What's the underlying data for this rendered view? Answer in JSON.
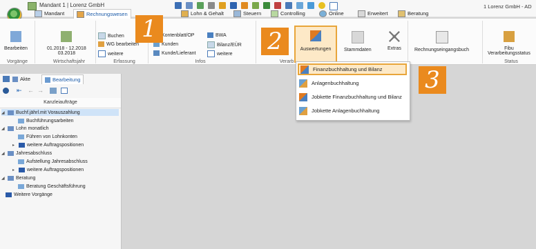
{
  "title_bar": {
    "mandant": "Mandant 1 | Lorenz GmbH",
    "right_text": "1 Lorenz GmbH - AD"
  },
  "ribbon_tabs": [
    "Mandant",
    "Rechnungswesen",
    "Lohn & Gehalt",
    "Steuern",
    "Controlling",
    "Online",
    "Erweitert",
    "Beratung"
  ],
  "ribbon": {
    "vorgaenge": {
      "bearbeiten": "Bearbeiten",
      "group": "Vorgänge"
    },
    "wirtschaftsjahr": {
      "range": "01.2018 - 12.2018",
      "current": "03.2018",
      "group": "Wirtschaftsjahr"
    },
    "erfassung": {
      "buchen": "Buchen",
      "wg": "WG bearbeiten",
      "weitere": "weitere",
      "group": "Erfassung"
    },
    "infos": {
      "kontenblatt": "Kontenblatt/OP",
      "kunden": "Kunden",
      "kunde_lieferant": "Kunde/Lieferant",
      "bwa": "BWA",
      "bilanz": "Bilanz/EÜR",
      "weitere": "weitere",
      "group": "Infos"
    },
    "auswertungen": "Auswertungen",
    "verarb_group": "Verarb",
    "stammdaten": "Stammdaten",
    "extras": "Extras",
    "rechnungseingangsbuch": "Rechnungseingangsbuch",
    "fibu": {
      "line1": "Fibu",
      "line2": "Verarbeitungsstatus",
      "group": "Status"
    }
  },
  "callouts": [
    "1",
    "2",
    "3"
  ],
  "dropdown": [
    "Finanzbuchhaltung und Bilanz",
    "Anlagenbuchhaltung",
    "Jobkette Finanzbuchhaltung und Bilanz",
    "Jobkette Anlagenbuchhaltung"
  ],
  "panel": {
    "tab_akte": "Akte",
    "tab_bearbeitung": "Bearbeitung",
    "header": "Kanzleiaufträge",
    "tree": [
      "Buchf.jährl.mit Vorauszahlung",
      "Buchführungsarbeiten",
      "Lohn monatlich",
      "Führen von Lohnkonten",
      "weitere Auftragspositionen",
      "Jahresabschluss",
      "Aufstellung Jahresabschluss",
      "weitere Auftragspositionen",
      "Beratung",
      "Beratung Geschäftsführung",
      "Weitere Vorgänge"
    ]
  }
}
